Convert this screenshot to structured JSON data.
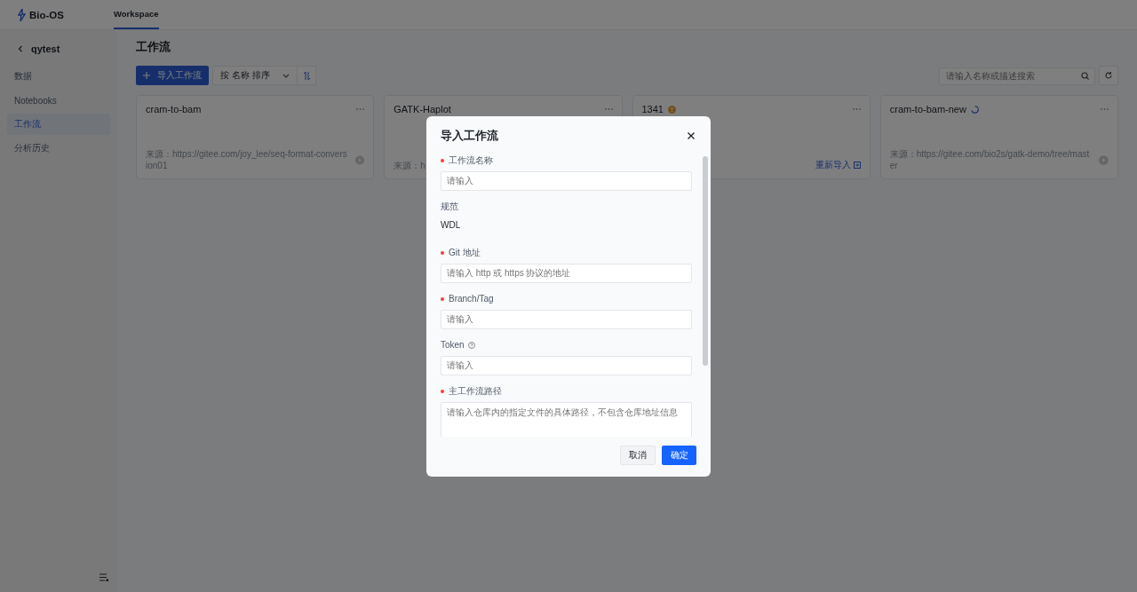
{
  "header": {
    "logo": "Bio-OS",
    "tabs": [
      {
        "label": "Workspace",
        "selected": true
      }
    ]
  },
  "sidebar": {
    "back_title": "qytest",
    "items": [
      {
        "label": "数据",
        "selected": false
      },
      {
        "label": "Notebooks",
        "selected": false
      },
      {
        "label": "工作流",
        "selected": true
      },
      {
        "label": "分析历史",
        "selected": false
      }
    ]
  },
  "page": {
    "title": "工作流",
    "import_button": "导入工作流",
    "sort_select": "按 名称 排序",
    "search": {
      "placeholder": "请输入名称或描述搜索"
    }
  },
  "cards": [
    {
      "title": "cram-to-bam",
      "warning": false,
      "loading": false,
      "source": "来源：https://gitee.com/joy_lee/seq-format-conversion01",
      "playable": true
    },
    {
      "title": "GATK-Haplot",
      "warning": false,
      "loading": false,
      "source": "来源：h"
    },
    {
      "title": "1341",
      "warning": true,
      "loading": false,
      "reimport_label": "重新导入"
    },
    {
      "title": "cram-to-bam-new",
      "warning": false,
      "loading": true,
      "source": "来源：https://gitee.com/bio2s/gatk-demo/tree/master",
      "playable": true
    }
  ],
  "modal": {
    "title": "导入工作流",
    "fields": [
      {
        "kind": "input",
        "label": "工作流名称",
        "required": true,
        "help": false,
        "placeholder": "请输入"
      },
      {
        "kind": "static",
        "label": "规范",
        "required": false,
        "help": false,
        "value": "WDL"
      },
      {
        "kind": "input",
        "label": "Git 地址",
        "required": true,
        "help": false,
        "placeholder": "请输入 http 或 https 协议的地址"
      },
      {
        "kind": "input",
        "label": "Branch/Tag",
        "required": true,
        "help": false,
        "placeholder": "请输入"
      },
      {
        "kind": "input",
        "label": "Token",
        "required": false,
        "help": true,
        "placeholder": "请输入"
      },
      {
        "kind": "textarea",
        "label": "主工作流路径",
        "required": true,
        "help": false,
        "placeholder": "请输入仓库内的指定文件的具体路径，不包含仓库地址信息"
      }
    ],
    "cancel": "取消",
    "confirm": "确定"
  }
}
